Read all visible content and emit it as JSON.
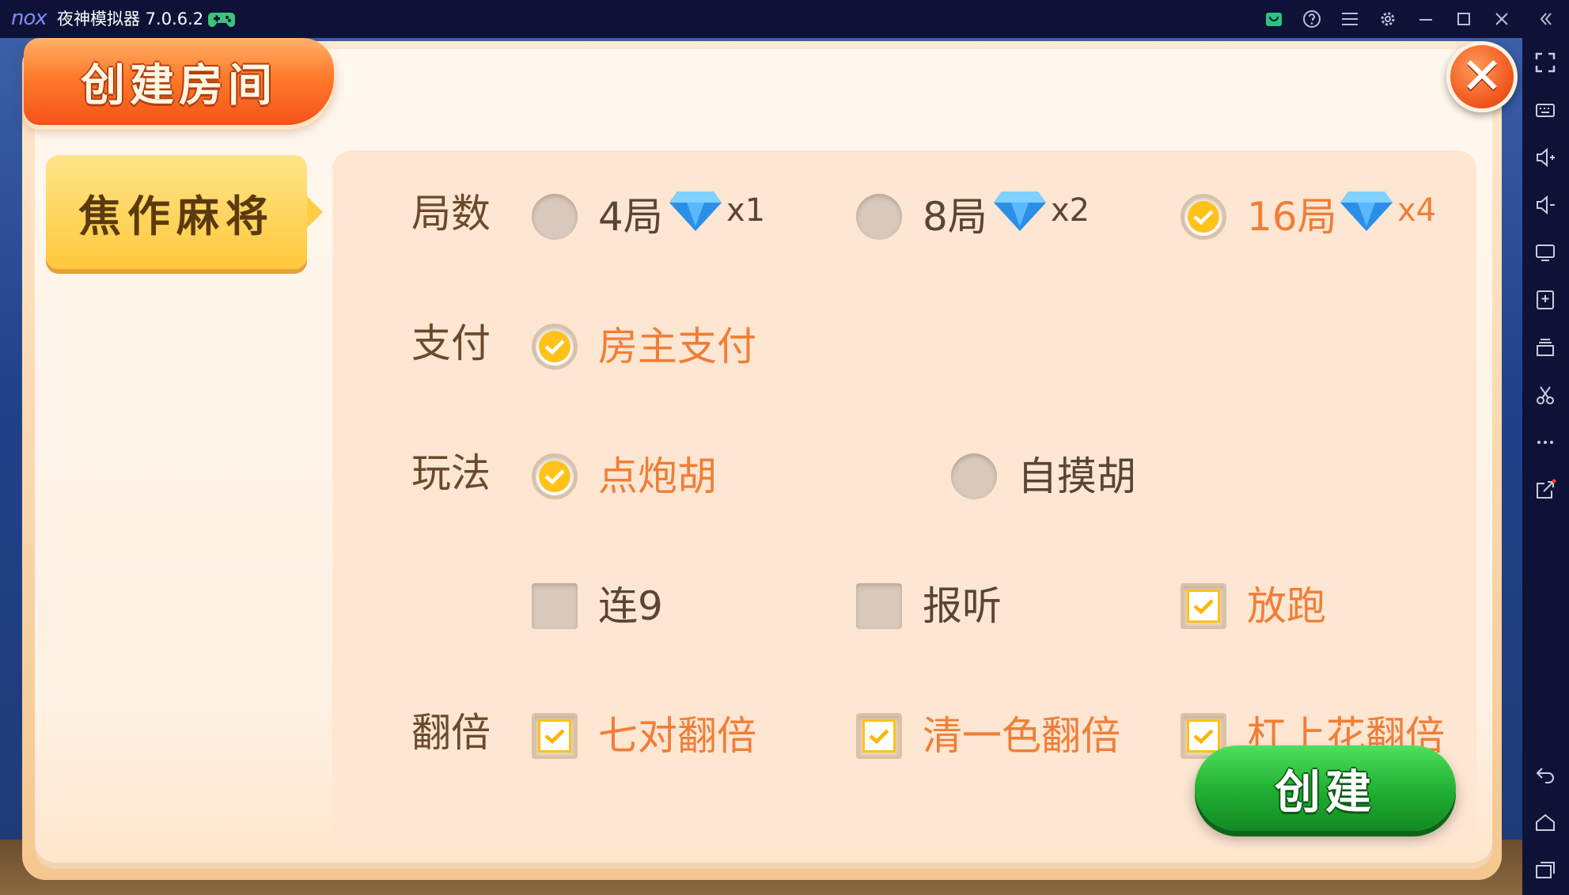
{
  "titlebar": {
    "logo": "nox",
    "title": "夜神模拟器 7.0.6.2"
  },
  "game": {
    "title": "创建房间",
    "mode_tab": "焦作麻将",
    "create_label": "创建",
    "rounds": {
      "label": "局数",
      "options": [
        {
          "label": "4局",
          "cost": "x1",
          "selected": false
        },
        {
          "label": "8局",
          "cost": "x2",
          "selected": false
        },
        {
          "label": "16局",
          "cost": "x4",
          "selected": true
        }
      ]
    },
    "payment": {
      "label": "支付",
      "options": [
        {
          "label": "房主支付",
          "selected": true
        }
      ]
    },
    "play": {
      "label": "玩法",
      "options": [
        {
          "label": "点炮胡",
          "selected": true
        },
        {
          "label": "自摸胡",
          "selected": false
        }
      ],
      "extras": [
        {
          "label": "连9",
          "checked": false
        },
        {
          "label": "报听",
          "checked": false
        },
        {
          "label": "放跑",
          "checked": true
        }
      ]
    },
    "double": {
      "label": "翻倍",
      "options": [
        {
          "label": "七对翻倍",
          "checked": true
        },
        {
          "label": "清一色翻倍",
          "checked": true
        },
        {
          "label": "杠上花翻倍",
          "checked": true
        }
      ]
    }
  },
  "colors": {
    "accent_orange": "#f07e37",
    "tick_yellow": "#ffc21a",
    "create_green": "#1fae31"
  }
}
